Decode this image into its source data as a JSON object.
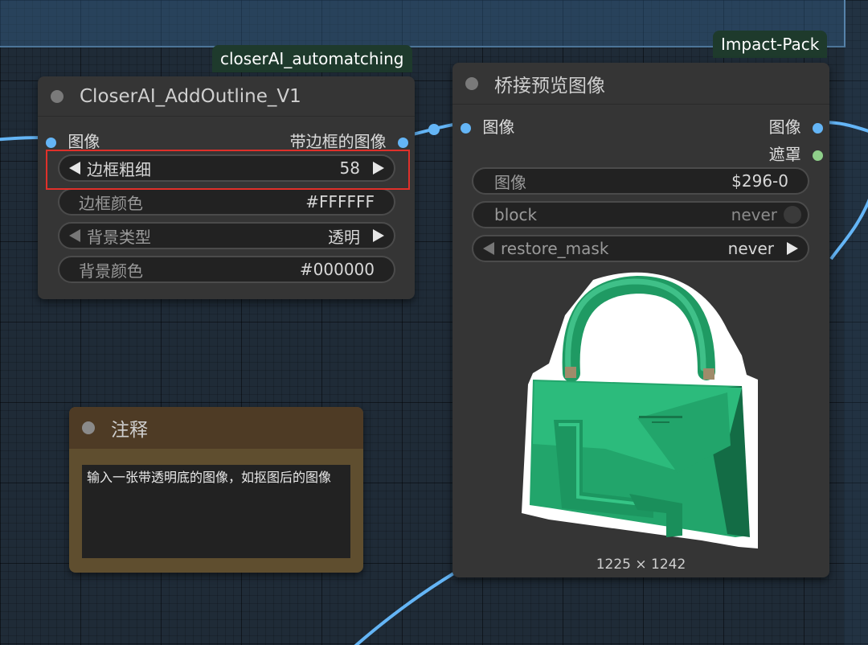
{
  "colors": {
    "canvas": "#1f2b37",
    "node": "#353535",
    "wire": "#64b5f6",
    "highlight": "#e0302a",
    "tag_bg": "#1e3a2c"
  },
  "tags": {
    "left": "closerAI_automatching",
    "right": "Impact-Pack"
  },
  "outline_node": {
    "title": "CloserAI_AddOutline_V1",
    "input_label": "图像",
    "output_label": "带边框的图像",
    "widgets": [
      {
        "label": "边框粗细",
        "value": "58"
      },
      {
        "label": "边框颜色",
        "value": "#FFFFFF"
      },
      {
        "label": "背景类型",
        "value": "透明"
      },
      {
        "label": "背景颜色",
        "value": "#000000"
      }
    ]
  },
  "preview_node": {
    "title": "桥接预览图像",
    "input_label": "图像",
    "outputs": [
      "图像",
      "遮罩"
    ],
    "widgets": [
      {
        "label": "图像",
        "value": "$296-0"
      },
      {
        "label": "block",
        "value": "never"
      },
      {
        "label": "restore_mask",
        "value": "never"
      }
    ],
    "image_alt": "green leather handbag with white outline",
    "image_size": "1225 × 1242"
  },
  "note_node": {
    "title": "注释",
    "text": "输入一张带透明底的图像，如抠图后的图像"
  }
}
